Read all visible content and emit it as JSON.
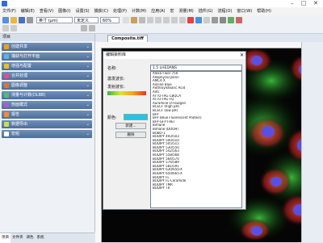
{
  "window": {
    "min": "–",
    "max": "□",
    "close": "✕"
  },
  "menu": [
    "文件(F)",
    "编辑(E)",
    "查看(V)",
    "图像(I)",
    "设置(S)",
    "捕获(C)",
    "处理(P)",
    "计数(M)",
    "应用(A)",
    "宏",
    "测量(M)",
    "插件(G)",
    "流程(O)",
    "窗口(W)",
    "帮助(H)"
  ],
  "toolbar": {
    "unit": "英寸 (μm)",
    "calib": "未定义",
    "zoom": "60%",
    "color": "#ffa500"
  },
  "left_panel": {
    "title": "项目",
    "items": [
      {
        "label": "创建共享",
        "color": "#f0a020"
      },
      {
        "label": "捕获与打开平面",
        "color": "#58b4e8"
      },
      {
        "label": "增强与配置",
        "color": "#e8c020"
      },
      {
        "label": "合并处理",
        "color": "#e84c8a"
      },
      {
        "label": "图像调整",
        "color": "#e87030"
      },
      {
        "label": "测量与计数(DLBB)",
        "color": "#4fbf6a"
      },
      {
        "label": "剖面模式",
        "color": "#b05ad0"
      },
      {
        "label": "报告",
        "color": "#ff8a30"
      },
      {
        "label": "数据导出",
        "color": "#c8e24a"
      },
      {
        "label": "宏组",
        "color": "#ffffff"
      }
    ],
    "tabs": [
      "项目",
      "文件夹",
      "调色",
      "系统"
    ]
  },
  "document": {
    "tab": "Composite.tiff"
  },
  "dialog": {
    "title": "编辑染料库",
    "close": "✕",
    "name_label": "名称:",
    "excitation_label": "激发波长:",
    "emission_label": "发射波长:",
    "color_label": "颜色:",
    "new_button": "新建...",
    "delete_button": "删除",
    "selected_dye": "1.5 LHEDANS",
    "dyes": [
      "Alexa Fluor 750",
      "Allophycocyanin",
      "AMCA X",
      "Aniline Blue",
      "Anthroylstearic Acid",
      "Anti",
      "ATTO-TAG CBQCA",
      "ATTO-TAG FQ",
      "Auramine O-Feulgen",
      "BCECF (high pH)",
      "BCECF (low pH)",
      "BFP",
      "BFP (Blue Fluorescent Protein)",
      "BFP-GFP FRET",
      "Bimane",
      "Bimane (DOOH)",
      "BOBO-1",
      "BODIPY 493/503",
      "BODIPY 500/510",
      "BODIPY 505/515",
      "BODIPY 530/550",
      "BODIPY 542/563",
      "BODIPY 558/568",
      "BODIPY 564/570",
      "BODIPY 576/589",
      "BODIPY 581/591",
      "BODIPY 630/650-X",
      "BODIPY 650/665-X",
      "BODIPY FL",
      "BODIPY FL-Ceramide",
      "BODIPY TMR",
      "BODIPY TR"
    ]
  }
}
